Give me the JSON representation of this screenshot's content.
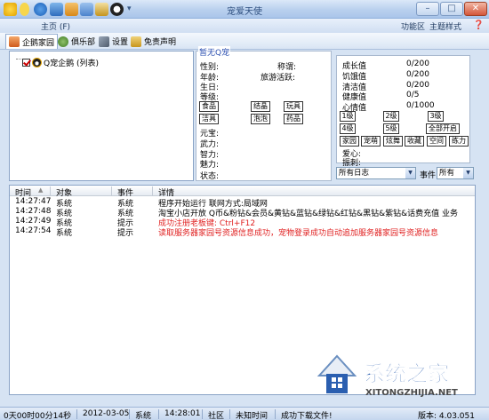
{
  "window": {
    "title": "宠爱天使"
  },
  "menu": {
    "main": "主页 (F)",
    "function_area": "功能区",
    "theme": "主题样式"
  },
  "toolbar": {
    "tabs": [
      {
        "label": "企鹅家园",
        "icon": "home-icon"
      },
      {
        "label": "俱乐部",
        "icon": "club-icon"
      },
      {
        "label": "设置",
        "icon": "settings-icon"
      },
      {
        "label": "免责声明",
        "icon": "disclaimer-icon"
      }
    ]
  },
  "tree": {
    "root_label": "Q宠企鹅 (列表)"
  },
  "pet": {
    "legend": "暂无Q宠",
    "fields": {
      "gender": "性别:",
      "title": "称谓:",
      "age": "年龄:",
      "travel": "旅游活跃:",
      "birthday": "生日:",
      "level": "等级:",
      "yuanbao": "元宝:",
      "force": "武力:",
      "wisdom": "智力:",
      "charm": "魅力:",
      "state": "状态:"
    },
    "buttons": {
      "food": "食品",
      "crystal": "结晶",
      "toy": "玩具",
      "clean": "洁具",
      "bubble": "泡泡",
      "medicine": "药品"
    }
  },
  "stats": [
    {
      "label": "成长值",
      "value": "0/200"
    },
    {
      "label": "饥饿值",
      "value": "0/200"
    },
    {
      "label": "清洁值",
      "value": "0/200"
    },
    {
      "label": "健康值",
      "value": "0/5"
    },
    {
      "label": "心情值",
      "value": "0/1000"
    }
  ],
  "levels": {
    "l1": "1级",
    "l2": "2级",
    "l3": "3级",
    "l4": "4级",
    "l5": "5级",
    "all": "全部开启"
  },
  "actions": {
    "home": "家园",
    "club": "宠萌",
    "show": "炫舞",
    "collect": "收藏",
    "space": "空间",
    "hp": "练力"
  },
  "extra": {
    "love": "爱心:",
    "brave": "振刺:"
  },
  "filters": {
    "log": "所有日志",
    "event_label": "事件",
    "event": "所有"
  },
  "log": {
    "headers": {
      "time": "时间",
      "object": "对象",
      "event": "事件",
      "detail": "详情"
    },
    "rows": [
      {
        "time": "14:27:47",
        "object": "系统",
        "event": "系统",
        "detail": "程序开始运行 联网方式:局域网",
        "color": "#000000"
      },
      {
        "time": "14:27:48",
        "object": "系统",
        "event": "系统",
        "detail": "淘宝小店开放 Q币&粉钻&会员&黄钻&蓝钻&绿钻&红钻&黑钻&紫钻&话费充值 业务",
        "color": "#000000"
      },
      {
        "time": "14:27:49",
        "object": "系统",
        "event": "提示",
        "detail": "成功注册老板键: Ctrl+F12",
        "color": "#e02020"
      },
      {
        "time": "14:27:54",
        "object": "系统",
        "event": "提示",
        "detail": "读取服务器家园号资源信息成功，宠物登录成功自动追加服务器家园号资源信息",
        "color": "#e02020"
      }
    ]
  },
  "status": {
    "uptime": "0天00时00分14秒",
    "date": "2012-03-05",
    "object": "系统",
    "time": "14:28:01",
    "community": "社区",
    "unknown_time": "未知时间",
    "download": "成功下载文件!",
    "version": "版本: 4.03.051"
  },
  "watermark": {
    "brand": "系统之家",
    "url": "XITONGZHIJIA.NET"
  },
  "colors": {
    "accent": "#2b4fb0",
    "error": "#e02020",
    "frame": "#d6e3f3"
  }
}
